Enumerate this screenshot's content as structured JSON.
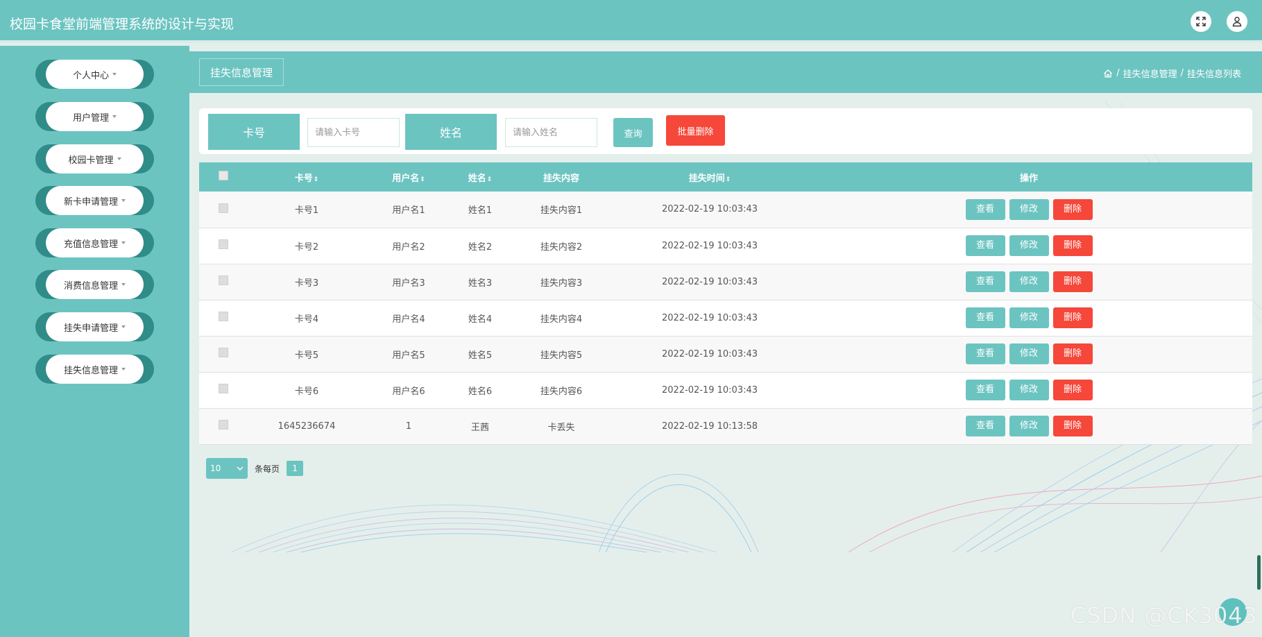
{
  "app": {
    "title": "校园卡食堂前端管理系统的设计与实现"
  },
  "header_icons": {
    "fullscreen": "fullscreen-icon",
    "user": "user-icon"
  },
  "sidebar": {
    "items": [
      {
        "label": "个人中心"
      },
      {
        "label": "用户管理"
      },
      {
        "label": "校园卡管理"
      },
      {
        "label": "新卡申请管理"
      },
      {
        "label": "充值信息管理"
      },
      {
        "label": "消费信息管理"
      },
      {
        "label": "挂失申请管理"
      },
      {
        "label": "挂失信息管理"
      }
    ]
  },
  "page": {
    "tab_label": "挂失信息管理",
    "breadcrumb": {
      "sep": "/",
      "level1": "挂失信息管理",
      "level2": "挂失信息列表"
    }
  },
  "search": {
    "card_label": "卡号",
    "card_placeholder": "请输入卡号",
    "name_label": "姓名",
    "name_placeholder": "请输入姓名",
    "query_label": "查询",
    "batch_delete_label": "批量删除"
  },
  "table": {
    "headers": {
      "card_no": "卡号",
      "username": "用户名",
      "name": "姓名",
      "content": "挂失内容",
      "time": "挂失时间",
      "ops": "操作"
    },
    "sort_glyph": "⇕",
    "rows": [
      {
        "card_no": "卡号1",
        "username": "用户名1",
        "name": "姓名1",
        "content": "挂失内容1",
        "time": "2022-02-19 10:03:43"
      },
      {
        "card_no": "卡号2",
        "username": "用户名2",
        "name": "姓名2",
        "content": "挂失内容2",
        "time": "2022-02-19 10:03:43"
      },
      {
        "card_no": "卡号3",
        "username": "用户名3",
        "name": "姓名3",
        "content": "挂失内容3",
        "time": "2022-02-19 10:03:43"
      },
      {
        "card_no": "卡号4",
        "username": "用户名4",
        "name": "姓名4",
        "content": "挂失内容4",
        "time": "2022-02-19 10:03:43"
      },
      {
        "card_no": "卡号5",
        "username": "用户名5",
        "name": "姓名5",
        "content": "挂失内容5",
        "time": "2022-02-19 10:03:43"
      },
      {
        "card_no": "卡号6",
        "username": "用户名6",
        "name": "姓名6",
        "content": "挂失内容6",
        "time": "2022-02-19 10:03:43"
      },
      {
        "card_no": "1645236674",
        "username": "1",
        "name": "王茜",
        "content": "卡丢失",
        "time": "2022-02-19 10:13:58"
      }
    ],
    "actions": {
      "view": "查看",
      "edit": "修改",
      "delete": "删除"
    }
  },
  "pagination": {
    "page_size": "10",
    "per_page_label": "条每页",
    "current_page": "1"
  },
  "watermark": "CSDN @CK3043",
  "colors": {
    "accent": "#6cc4c1",
    "sidebar_dark": "#2f8c88",
    "danger": "#f5473a",
    "background": "#e4efec"
  }
}
